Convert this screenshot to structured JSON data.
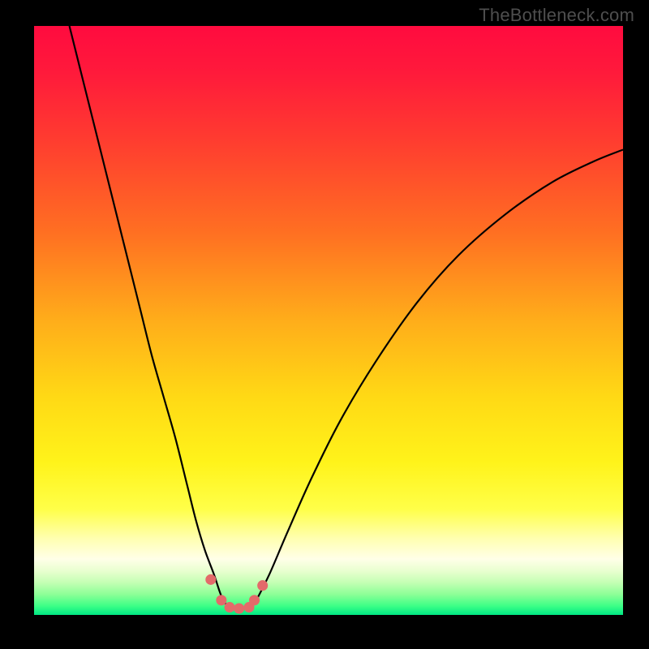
{
  "watermark": "TheBottleneck.com",
  "chart_data": {
    "type": "line",
    "title": "",
    "xlabel": "",
    "ylabel": "",
    "xlim": [
      0,
      100
    ],
    "ylim": [
      0,
      100
    ],
    "grid": false,
    "legend": false,
    "background_gradient_stops": [
      {
        "offset": 0.0,
        "color": "#ff0b3f"
      },
      {
        "offset": 0.08,
        "color": "#ff1a3b"
      },
      {
        "offset": 0.2,
        "color": "#ff3e2f"
      },
      {
        "offset": 0.35,
        "color": "#ff6f22"
      },
      {
        "offset": 0.5,
        "color": "#ffad1a"
      },
      {
        "offset": 0.63,
        "color": "#ffd915"
      },
      {
        "offset": 0.74,
        "color": "#fff31a"
      },
      {
        "offset": 0.82,
        "color": "#ffff48"
      },
      {
        "offset": 0.87,
        "color": "#ffffb0"
      },
      {
        "offset": 0.905,
        "color": "#ffffe8"
      },
      {
        "offset": 0.925,
        "color": "#e9ffd0"
      },
      {
        "offset": 0.945,
        "color": "#c4ffb4"
      },
      {
        "offset": 0.965,
        "color": "#8dff97"
      },
      {
        "offset": 0.985,
        "color": "#3cff86"
      },
      {
        "offset": 1.0,
        "color": "#00e784"
      }
    ],
    "series": [
      {
        "name": "bottleneck-curve-left",
        "color": "#000000",
        "x": [
          6,
          8,
          10,
          12,
          14,
          16,
          18,
          20,
          22,
          24,
          26,
          27.5,
          29,
          30.5,
          31.5,
          32.2,
          33
        ],
        "values": [
          100,
          92,
          84,
          76,
          68,
          60,
          52,
          44,
          37,
          30,
          22,
          16,
          11,
          7,
          4,
          2.3,
          1.5
        ]
      },
      {
        "name": "bottleneck-curve-right",
        "color": "#000000",
        "x": [
          37,
          38,
          40,
          43,
          47,
          52,
          58,
          65,
          72,
          80,
          88,
          95,
          100
        ],
        "values": [
          1.5,
          3,
          7,
          14,
          23,
          33,
          43,
          53,
          61,
          68,
          73.5,
          77,
          79
        ]
      },
      {
        "name": "floor-segment",
        "color": "#000000",
        "x": [
          33,
          34,
          35,
          36,
          37
        ],
        "values": [
          1.5,
          1.2,
          1.1,
          1.2,
          1.5
        ]
      }
    ],
    "markers": {
      "name": "data-points",
      "color": "#e36a6a",
      "points": [
        {
          "x": 30.0,
          "y": 6.0
        },
        {
          "x": 31.8,
          "y": 2.5
        },
        {
          "x": 33.2,
          "y": 1.3
        },
        {
          "x": 34.8,
          "y": 1.1
        },
        {
          "x": 36.5,
          "y": 1.3
        },
        {
          "x": 37.4,
          "y": 2.5
        },
        {
          "x": 38.8,
          "y": 5.0
        }
      ]
    }
  }
}
